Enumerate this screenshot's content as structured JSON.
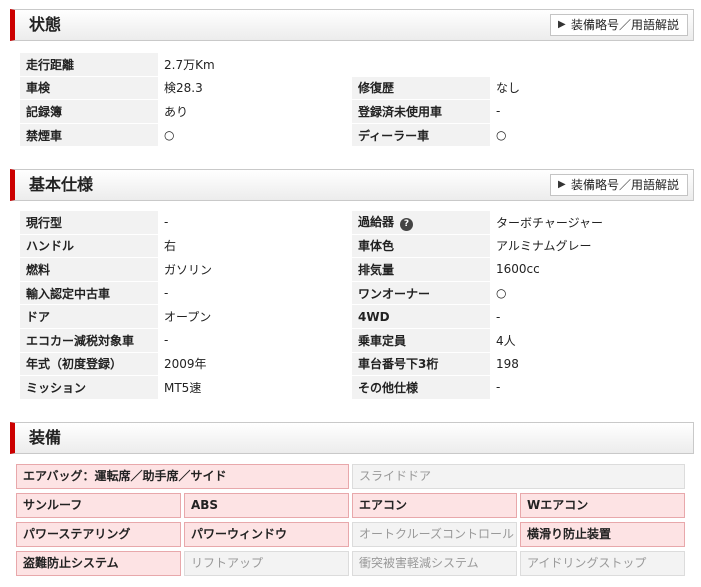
{
  "status": {
    "title": "状態",
    "button_label": "装備略号／用語解説",
    "rows": [
      [
        {
          "k": "走行距離",
          "v": "2.7万Km"
        },
        {
          "k": "",
          "v": ""
        }
      ],
      [
        {
          "k": "車検",
          "v": "検28.3"
        },
        {
          "k": "修復歴",
          "v": "なし"
        }
      ],
      [
        {
          "k": "記録簿",
          "v": "あり"
        },
        {
          "k": "登録済未使用車",
          "v": "-"
        }
      ],
      [
        {
          "k": "禁煙車",
          "v": "○"
        },
        {
          "k": "ディーラー車",
          "v": "○"
        }
      ]
    ]
  },
  "basic": {
    "title": "基本仕様",
    "button_label": "装備略号／用語解説",
    "help_icon": "question-circle-icon",
    "rows": [
      [
        {
          "k": "現行型",
          "v": "-"
        },
        {
          "k": "過給器",
          "v": "ターボチャージャー",
          "help": "?"
        }
      ],
      [
        {
          "k": "ハンドル",
          "v": "右"
        },
        {
          "k": "車体色",
          "v": "アルミナムグレー"
        }
      ],
      [
        {
          "k": "燃料",
          "v": "ガソリン"
        },
        {
          "k": "排気量",
          "v": "1600cc"
        }
      ],
      [
        {
          "k": "輸入認定中古車",
          "v": "-"
        },
        {
          "k": "ワンオーナー",
          "v": "○"
        }
      ],
      [
        {
          "k": "ドア",
          "v": "オープン"
        },
        {
          "k": "4WD",
          "v": "-"
        }
      ],
      [
        {
          "k": "エコカー減税対象車",
          "v": "-"
        },
        {
          "k": "乗車定員",
          "v": "4人"
        }
      ],
      [
        {
          "k": "年式（初度登録）",
          "v": "2009年"
        },
        {
          "k": "車台番号下3桁",
          "v": "198"
        }
      ],
      [
        {
          "k": "ミッション",
          "v": "MT5速"
        },
        {
          "k": "その他仕様",
          "v": "-"
        }
      ]
    ]
  },
  "equipment": {
    "title": "装備",
    "colors": {
      "on_bg": "#fde3e4",
      "on_border": "#e8a8ab",
      "off_bg": "#f3f3f3",
      "off_text": "#999999",
      "accent": "#cc0000"
    },
    "rows": [
      [
        {
          "label": "エアバッグ：運転席／助手席／サイド",
          "on": true,
          "wide": true
        },
        {
          "label": "スライドドア",
          "on": false,
          "wide": true
        }
      ],
      [
        {
          "label": "サンルーフ",
          "on": true
        },
        {
          "label": "ABS",
          "on": true
        },
        {
          "label": "エアコン",
          "on": true
        },
        {
          "label": "Wエアコン",
          "on": true
        }
      ],
      [
        {
          "label": "パワーステアリング",
          "on": true
        },
        {
          "label": "パワーウィンドウ",
          "on": true
        },
        {
          "label": "オートクルーズコントロール",
          "on": false
        },
        {
          "label": "横滑り防止装置",
          "on": true
        }
      ],
      [
        {
          "label": "盗難防止システム",
          "on": true
        },
        {
          "label": "リフトアップ",
          "on": false
        },
        {
          "label": "衝突被害軽減システム",
          "on": false
        },
        {
          "label": "アイドリングストップ",
          "on": false
        }
      ]
    ]
  }
}
